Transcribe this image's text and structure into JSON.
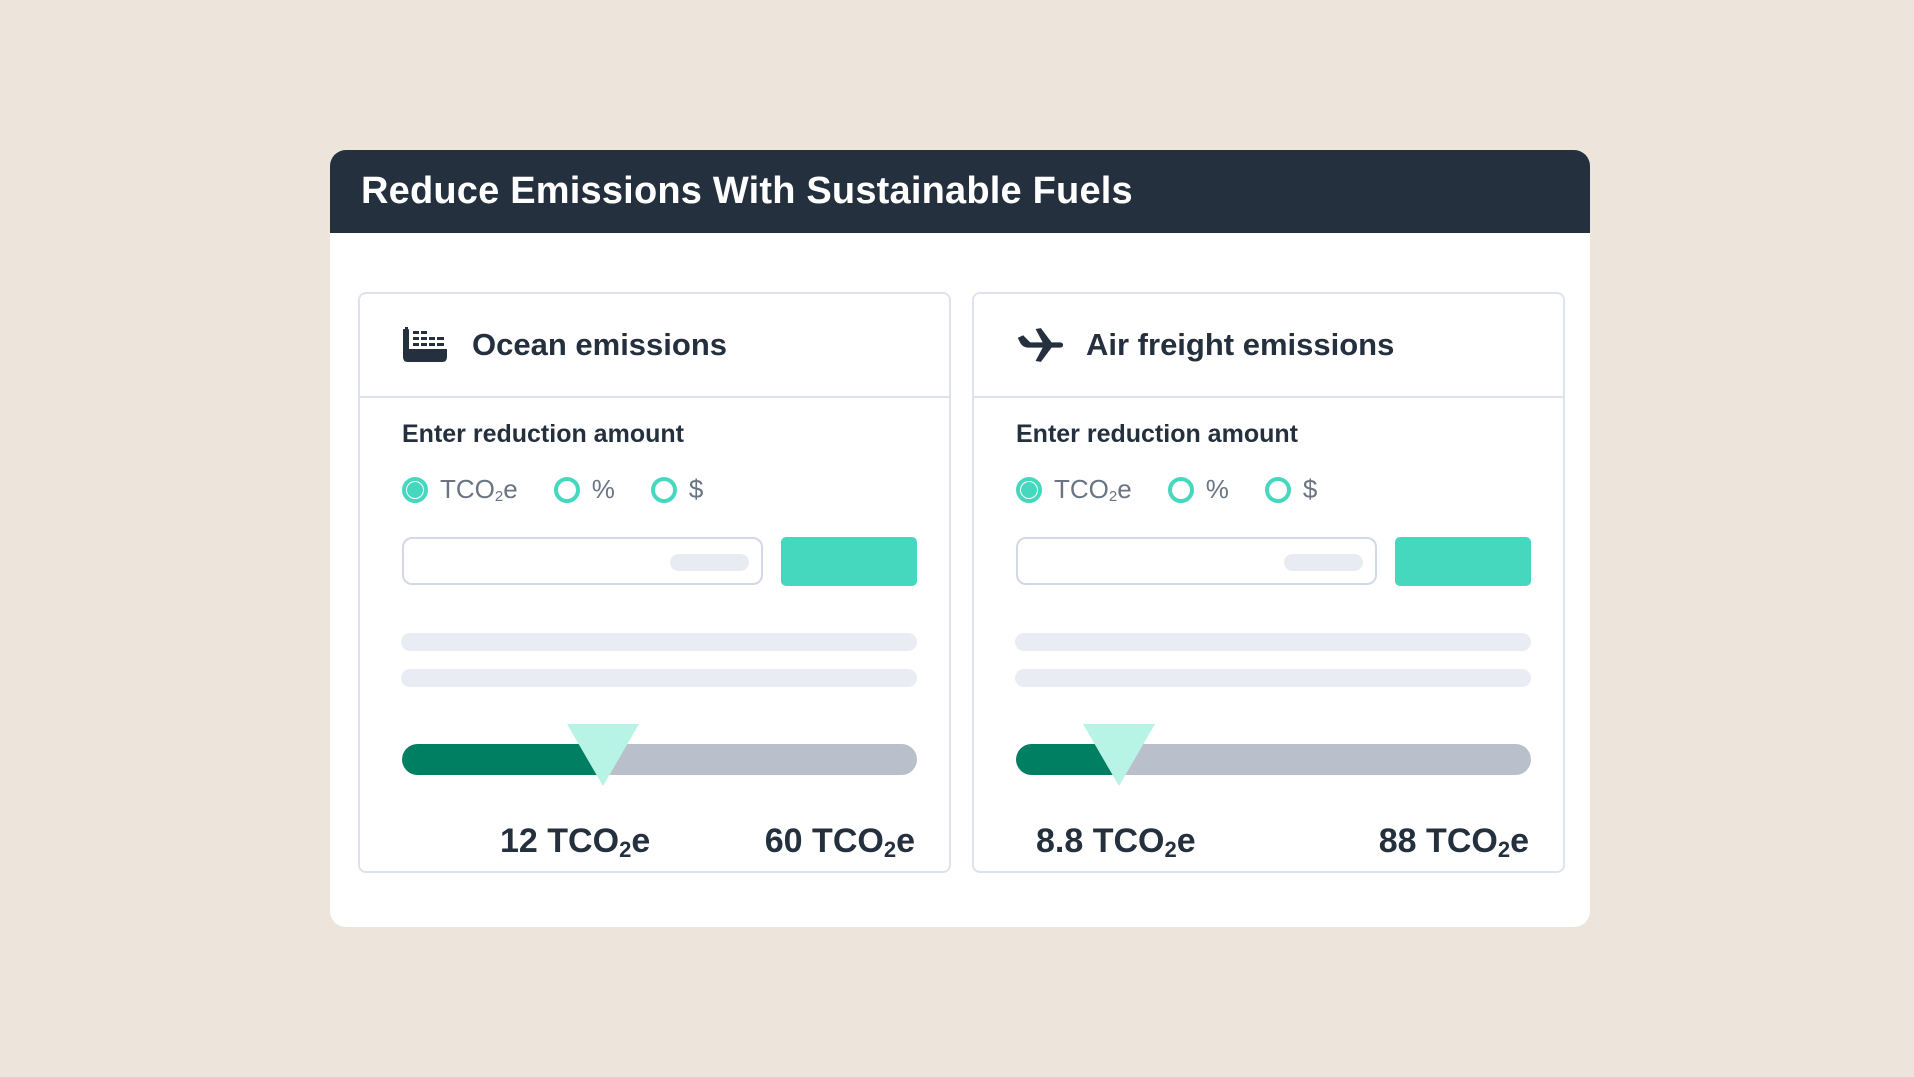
{
  "header": {
    "title": "Reduce Emissions With Sustainable Fuels"
  },
  "colors": {
    "background": "#ede5dc",
    "header_bg": "#24303e",
    "accent": "#46d8be",
    "slider_fill": "#007f62",
    "slider_track": "#b9c0cc",
    "slider_thumb": "#b7f4e6"
  },
  "panels": [
    {
      "id": "ocean",
      "icon": "ship-icon",
      "title": "Ocean emissions",
      "label": "Enter reduction amount",
      "units": [
        {
          "label": "TCO",
          "sub": "2",
          "suffix": "e",
          "selected": true
        },
        {
          "label": "%",
          "sub": "",
          "suffix": "",
          "selected": false
        },
        {
          "label": "$",
          "sub": "",
          "suffix": "",
          "selected": false
        }
      ],
      "input_value": "",
      "slider": {
        "position": 0.39
      },
      "current_value": {
        "num": "12",
        "unit": "TCO",
        "sub": "2",
        "suffix": "e"
      },
      "max_value": {
        "num": "60",
        "unit": "TCO",
        "sub": "2",
        "suffix": "e"
      }
    },
    {
      "id": "air",
      "icon": "airplane-icon",
      "title": "Air freight emissions",
      "label": "Enter reduction amount",
      "units": [
        {
          "label": "TCO",
          "sub": "2",
          "suffix": "e",
          "selected": true
        },
        {
          "label": "%",
          "sub": "",
          "suffix": "",
          "selected": false
        },
        {
          "label": "$",
          "sub": "",
          "suffix": "",
          "selected": false
        }
      ],
      "input_value": "",
      "slider": {
        "position": 0.2
      },
      "current_value": {
        "num": "8.8",
        "unit": "TCO",
        "sub": "2",
        "suffix": "e"
      },
      "max_value": {
        "num": "88",
        "unit": "TCO",
        "sub": "2",
        "suffix": "e"
      }
    }
  ]
}
